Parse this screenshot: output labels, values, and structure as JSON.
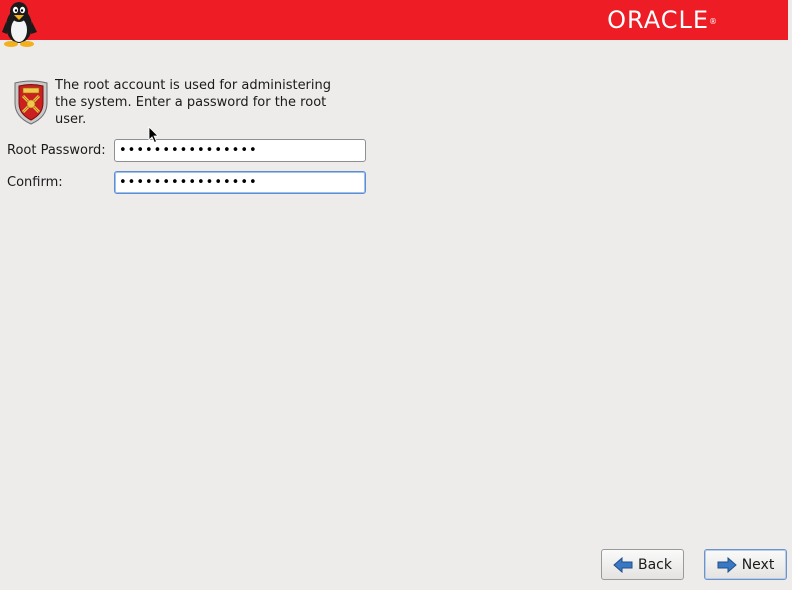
{
  "header": {
    "brand": "ORACLE",
    "brand_mark": "®",
    "banner_color": "#ee1c25",
    "left_icon": "tux-penguin-icon"
  },
  "content": {
    "icon": "security-shield-icon",
    "description": "The root account is used for administering the system.  Enter a password for the root user.",
    "root_password": {
      "label": "Root Password:",
      "value": "••••••••••••••••"
    },
    "confirm": {
      "label": "Confirm:",
      "value": "••••••••••••••••"
    }
  },
  "buttons": {
    "back": {
      "label": "Back",
      "icon": "arrow-left-icon"
    },
    "next": {
      "label": "Next",
      "icon": "arrow-right-icon"
    }
  }
}
